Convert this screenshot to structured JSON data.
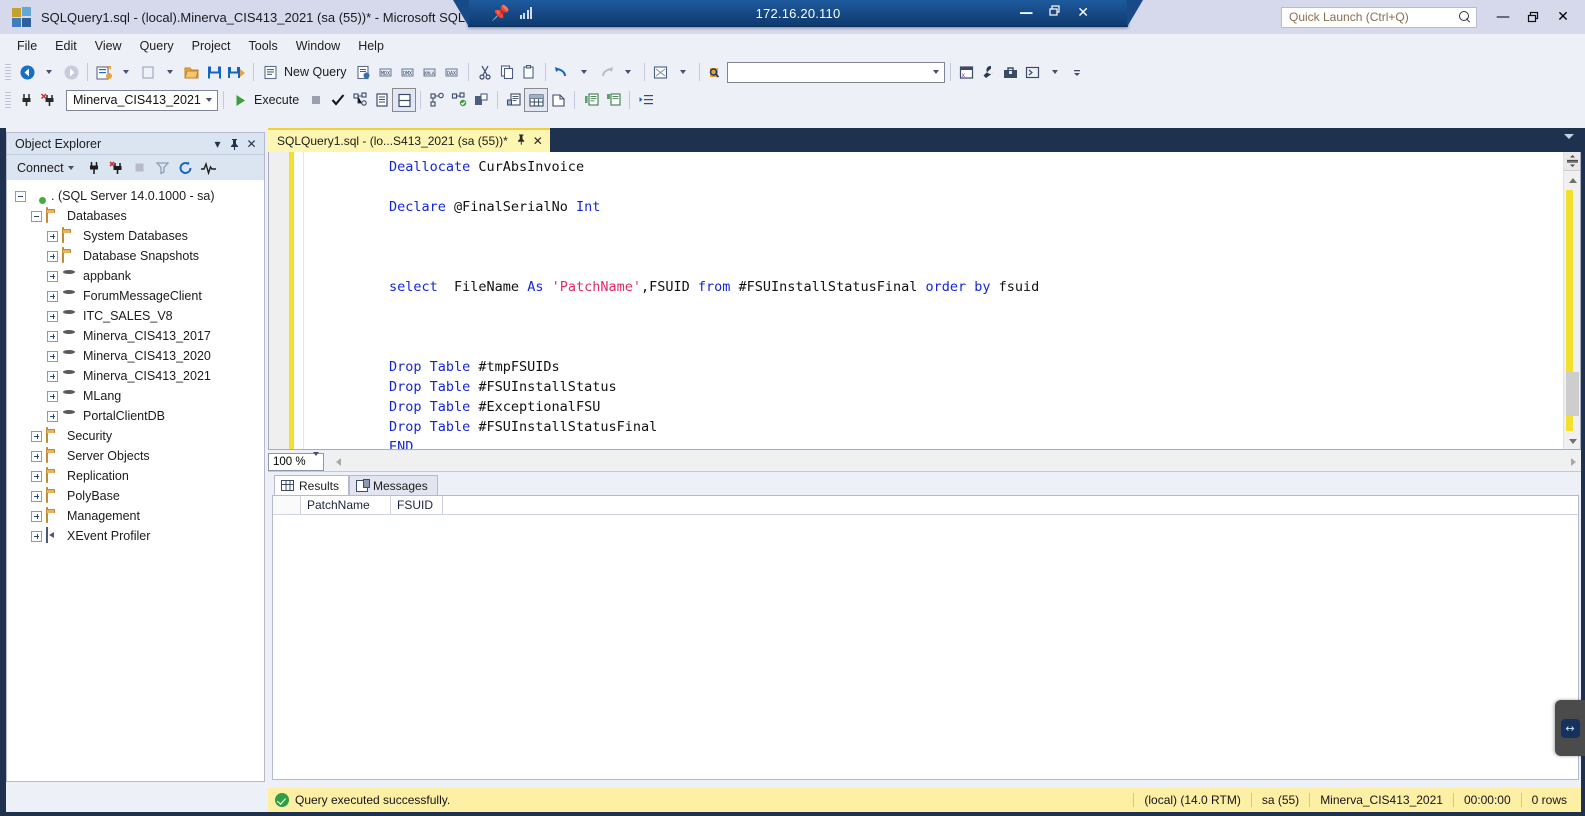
{
  "window": {
    "title": "SQLQuery1.sql - (local).Minerva_CIS413_2021 (sa (55))* - Microsoft SQL Server Management Studio",
    "logo_name": "ssms-logo",
    "minimize": "—",
    "restore": "❐",
    "close": "✕"
  },
  "rdp_bar": {
    "pin_label": "┆",
    "host": "172.16.20.110",
    "minimize": "—",
    "restore": "❐",
    "close": "✕"
  },
  "quick_launch": {
    "placeholder": "Quick Launch (Ctrl+Q)",
    "value": "Quick Launch (Ctrl+Q)"
  },
  "menu": {
    "items": [
      "File",
      "Edit",
      "View",
      "Query",
      "Project",
      "Tools",
      "Window",
      "Help"
    ]
  },
  "toolbar_standard": {
    "nav_back": "navigate-back-icon",
    "nav_forward": "navigate-forward-icon",
    "new_project": "new-project-icon",
    "open_file": "open-file-icon",
    "open_folder": "open-folder-icon",
    "save": "save-icon",
    "save_all": "save-all-icon",
    "new_query_label": "New Query",
    "new_query_icon": "new-query-icon",
    "db_engine_query": "database-engine-query-icon",
    "mdx_query": "mdx-query-icon",
    "dmx_query": "dmx-query-icon",
    "xmla_query": "xmla-query-icon",
    "dax_query": "dax-query-icon",
    "cut": "cut-icon",
    "copy": "copy-icon",
    "paste": "paste-icon",
    "undo": "undo-icon",
    "redo": "redo-icon",
    "registered_servers": "registered-servers-icon",
    "find": "find-icon",
    "find_combo_value": "",
    "window_layout": "window-layout-icon",
    "options": "wrench-icon",
    "toolbox": "toolbox-icon",
    "powershell": "powershell-icon",
    "overflow": "toolbar-overflow-icon"
  },
  "toolbar_query": {
    "connect": "connect-icon",
    "disconnect": "disconnect-icon",
    "database_value": "Minerva_CIS413_2021",
    "execute_label": "Execute",
    "stop": "stop-icon",
    "parse": "parse-check-icon",
    "display_estimated_plan": "estimated-execution-plan-icon",
    "query_options": "query-options-icon",
    "intellisense": "intellisense-toggle-icon",
    "include_actual_plan": "actual-execution-plan-icon",
    "include_live_stats": "live-query-stats-icon",
    "include_client_stats": "client-statistics-icon",
    "results_to_text": "results-to-text-icon",
    "results_to_grid": "results-to-grid-icon",
    "results_to_file": "results-to-file-icon",
    "comment": "comment-lines-icon",
    "uncomment": "uncomment-lines-icon",
    "indent": "increase-indent-icon",
    "outdent": "decrease-indent-icon",
    "specify_values": "specify-values-icon"
  },
  "object_explorer": {
    "title": "Object Explorer",
    "dropdown": "▾",
    "pin": "┆",
    "close": "✕",
    "connect_label": "Connect",
    "tool_icons": [
      "connect-plug-icon",
      "disconnect-plug-icon",
      "stop-icon",
      "filter-icon",
      "refresh-icon",
      "activity-monitor-icon"
    ],
    "tree": [
      {
        "label": ". (SQL Server 14.0.1000 - sa)",
        "indent": 0,
        "icon": "server",
        "state": "minus"
      },
      {
        "label": "Databases",
        "indent": 1,
        "icon": "folder",
        "state": "minus"
      },
      {
        "label": "System Databases",
        "indent": 2,
        "icon": "folder",
        "state": "plus"
      },
      {
        "label": "Database Snapshots",
        "indent": 2,
        "icon": "folder",
        "state": "plus"
      },
      {
        "label": "appbank",
        "indent": 2,
        "icon": "db",
        "state": "plus"
      },
      {
        "label": "ForumMessageClient",
        "indent": 2,
        "icon": "db",
        "state": "plus"
      },
      {
        "label": "ITC_SALES_V8",
        "indent": 2,
        "icon": "db",
        "state": "plus"
      },
      {
        "label": "Minerva_CIS413_2017",
        "indent": 2,
        "icon": "db",
        "state": "plus"
      },
      {
        "label": "Minerva_CIS413_2020",
        "indent": 2,
        "icon": "db",
        "state": "plus"
      },
      {
        "label": "Minerva_CIS413_2021",
        "indent": 2,
        "icon": "db",
        "state": "plus"
      },
      {
        "label": "MLang",
        "indent": 2,
        "icon": "db",
        "state": "plus"
      },
      {
        "label": "PortalClientDB",
        "indent": 2,
        "icon": "db",
        "state": "plus"
      },
      {
        "label": "Security",
        "indent": 1,
        "icon": "folder",
        "state": "plus"
      },
      {
        "label": "Server Objects",
        "indent": 1,
        "icon": "folder",
        "state": "plus"
      },
      {
        "label": "Replication",
        "indent": 1,
        "icon": "folder",
        "state": "plus"
      },
      {
        "label": "PolyBase",
        "indent": 1,
        "icon": "folder",
        "state": "plus"
      },
      {
        "label": "Management",
        "indent": 1,
        "icon": "folder",
        "state": "plus"
      },
      {
        "label": "XEvent Profiler",
        "indent": 1,
        "icon": "xevent",
        "state": "plus"
      }
    ]
  },
  "editor": {
    "tab_label": "SQLQuery1.sql - (lo...S413_2021 (sa (55))*",
    "tab_pin": "┆",
    "tab_close": "✕",
    "lines": [
      [
        {
          "t": "Deallocate ",
          "c": "kw"
        },
        {
          "t": "CurAbsInvoice",
          "c": "plain"
        }
      ],
      [],
      [
        {
          "t": "Declare ",
          "c": "kw"
        },
        {
          "t": "@FinalSerialNo ",
          "c": "plain"
        },
        {
          "t": "Int",
          "c": "kw"
        }
      ],
      [],
      [],
      [],
      [
        {
          "t": "select ",
          "c": "kw"
        },
        {
          "t": " FileName ",
          "c": "plain"
        },
        {
          "t": "As ",
          "c": "kw"
        },
        {
          "t": "'PatchName'",
          "c": "str"
        },
        {
          "t": ",FSUID ",
          "c": "plain"
        },
        {
          "t": "from ",
          "c": "kw"
        },
        {
          "t": "#FSUInstallStatusFinal ",
          "c": "plain"
        },
        {
          "t": "order by ",
          "c": "kw"
        },
        {
          "t": "fsuid",
          "c": "plain"
        }
      ],
      [],
      [],
      [],
      [
        {
          "t": "Drop Table ",
          "c": "kw"
        },
        {
          "t": "#tmpFSUIDs",
          "c": "plain"
        }
      ],
      [
        {
          "t": "Drop Table ",
          "c": "kw"
        },
        {
          "t": "#FSUInstallStatus",
          "c": "plain"
        }
      ],
      [
        {
          "t": "Drop Table ",
          "c": "kw"
        },
        {
          "t": "#ExceptionalFSU",
          "c": "plain"
        }
      ],
      [
        {
          "t": "Drop Table ",
          "c": "kw"
        },
        {
          "t": "#FSUInstallStatusFinal",
          "c": "plain"
        }
      ],
      [
        {
          "t": "END",
          "c": "kw"
        }
      ]
    ]
  },
  "zoom_bar": {
    "zoom_value": "100 %",
    "zoom_arrow": "▾"
  },
  "results_pane": {
    "tabs": [
      {
        "label": "Results",
        "icon": "results-grid-icon",
        "active": true
      },
      {
        "label": "Messages",
        "icon": "messages-icon",
        "active": false
      }
    ],
    "columns": [
      "PatchName",
      "FSUID"
    ],
    "rows": []
  },
  "status_bar": {
    "message": "Query executed successfully.",
    "status_icon": "success-check-icon",
    "server": "(local) (14.0 RTM)",
    "user": "sa (55)",
    "database": "Minerva_CIS413_2021",
    "elapsed": "00:00:00",
    "rows": "0 rows"
  },
  "floating": {
    "teamviewer_tab": "remote-control-tab-icon"
  },
  "colors": {
    "title_bar": "#d6d9ec",
    "rdp_bar": "#174a86",
    "tab_active": "#fdf6b3",
    "status_bar": "#fdf0a5",
    "keyword": "#1427d6",
    "string": "#e2296b",
    "chrome_dark": "#1e3250",
    "oe_header": "#dbe5f1"
  }
}
